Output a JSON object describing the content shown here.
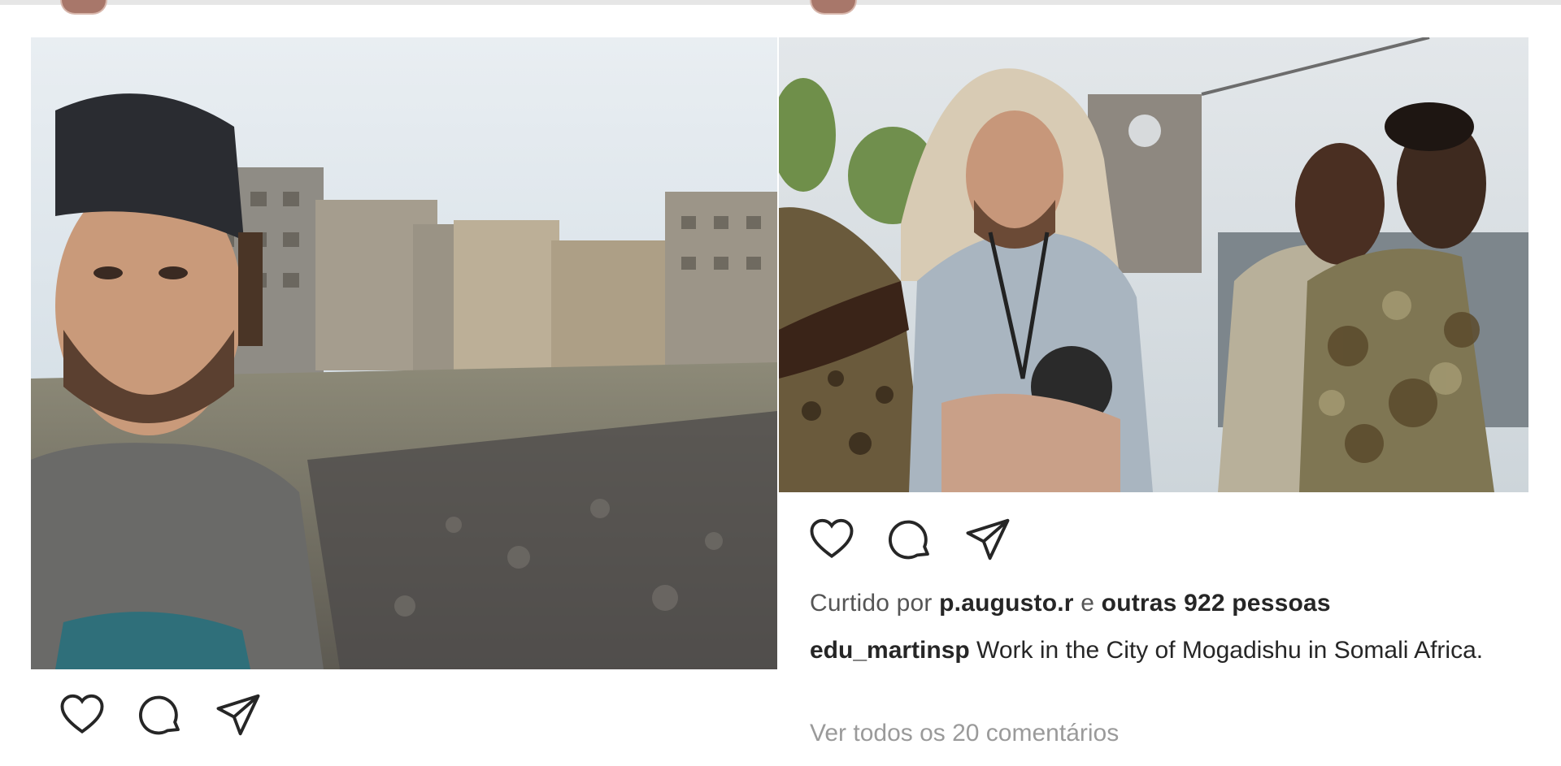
{
  "post_right": {
    "likes_prefix": "Curtido por",
    "likes_user": "p.augusto.r",
    "likes_mid": "e",
    "likes_rest": "outras 922 pessoas",
    "caption_user": "edu_martinsp",
    "caption_text": " Work in the City of Mogadishu in Somali Africa.",
    "view_comments": "Ver todos os 20 comentários"
  },
  "icons": {
    "like": "heart-icon",
    "comment": "comment-icon",
    "share": "share-icon"
  },
  "colors": {
    "text": "#262626",
    "muted": "#9a9a9a"
  }
}
